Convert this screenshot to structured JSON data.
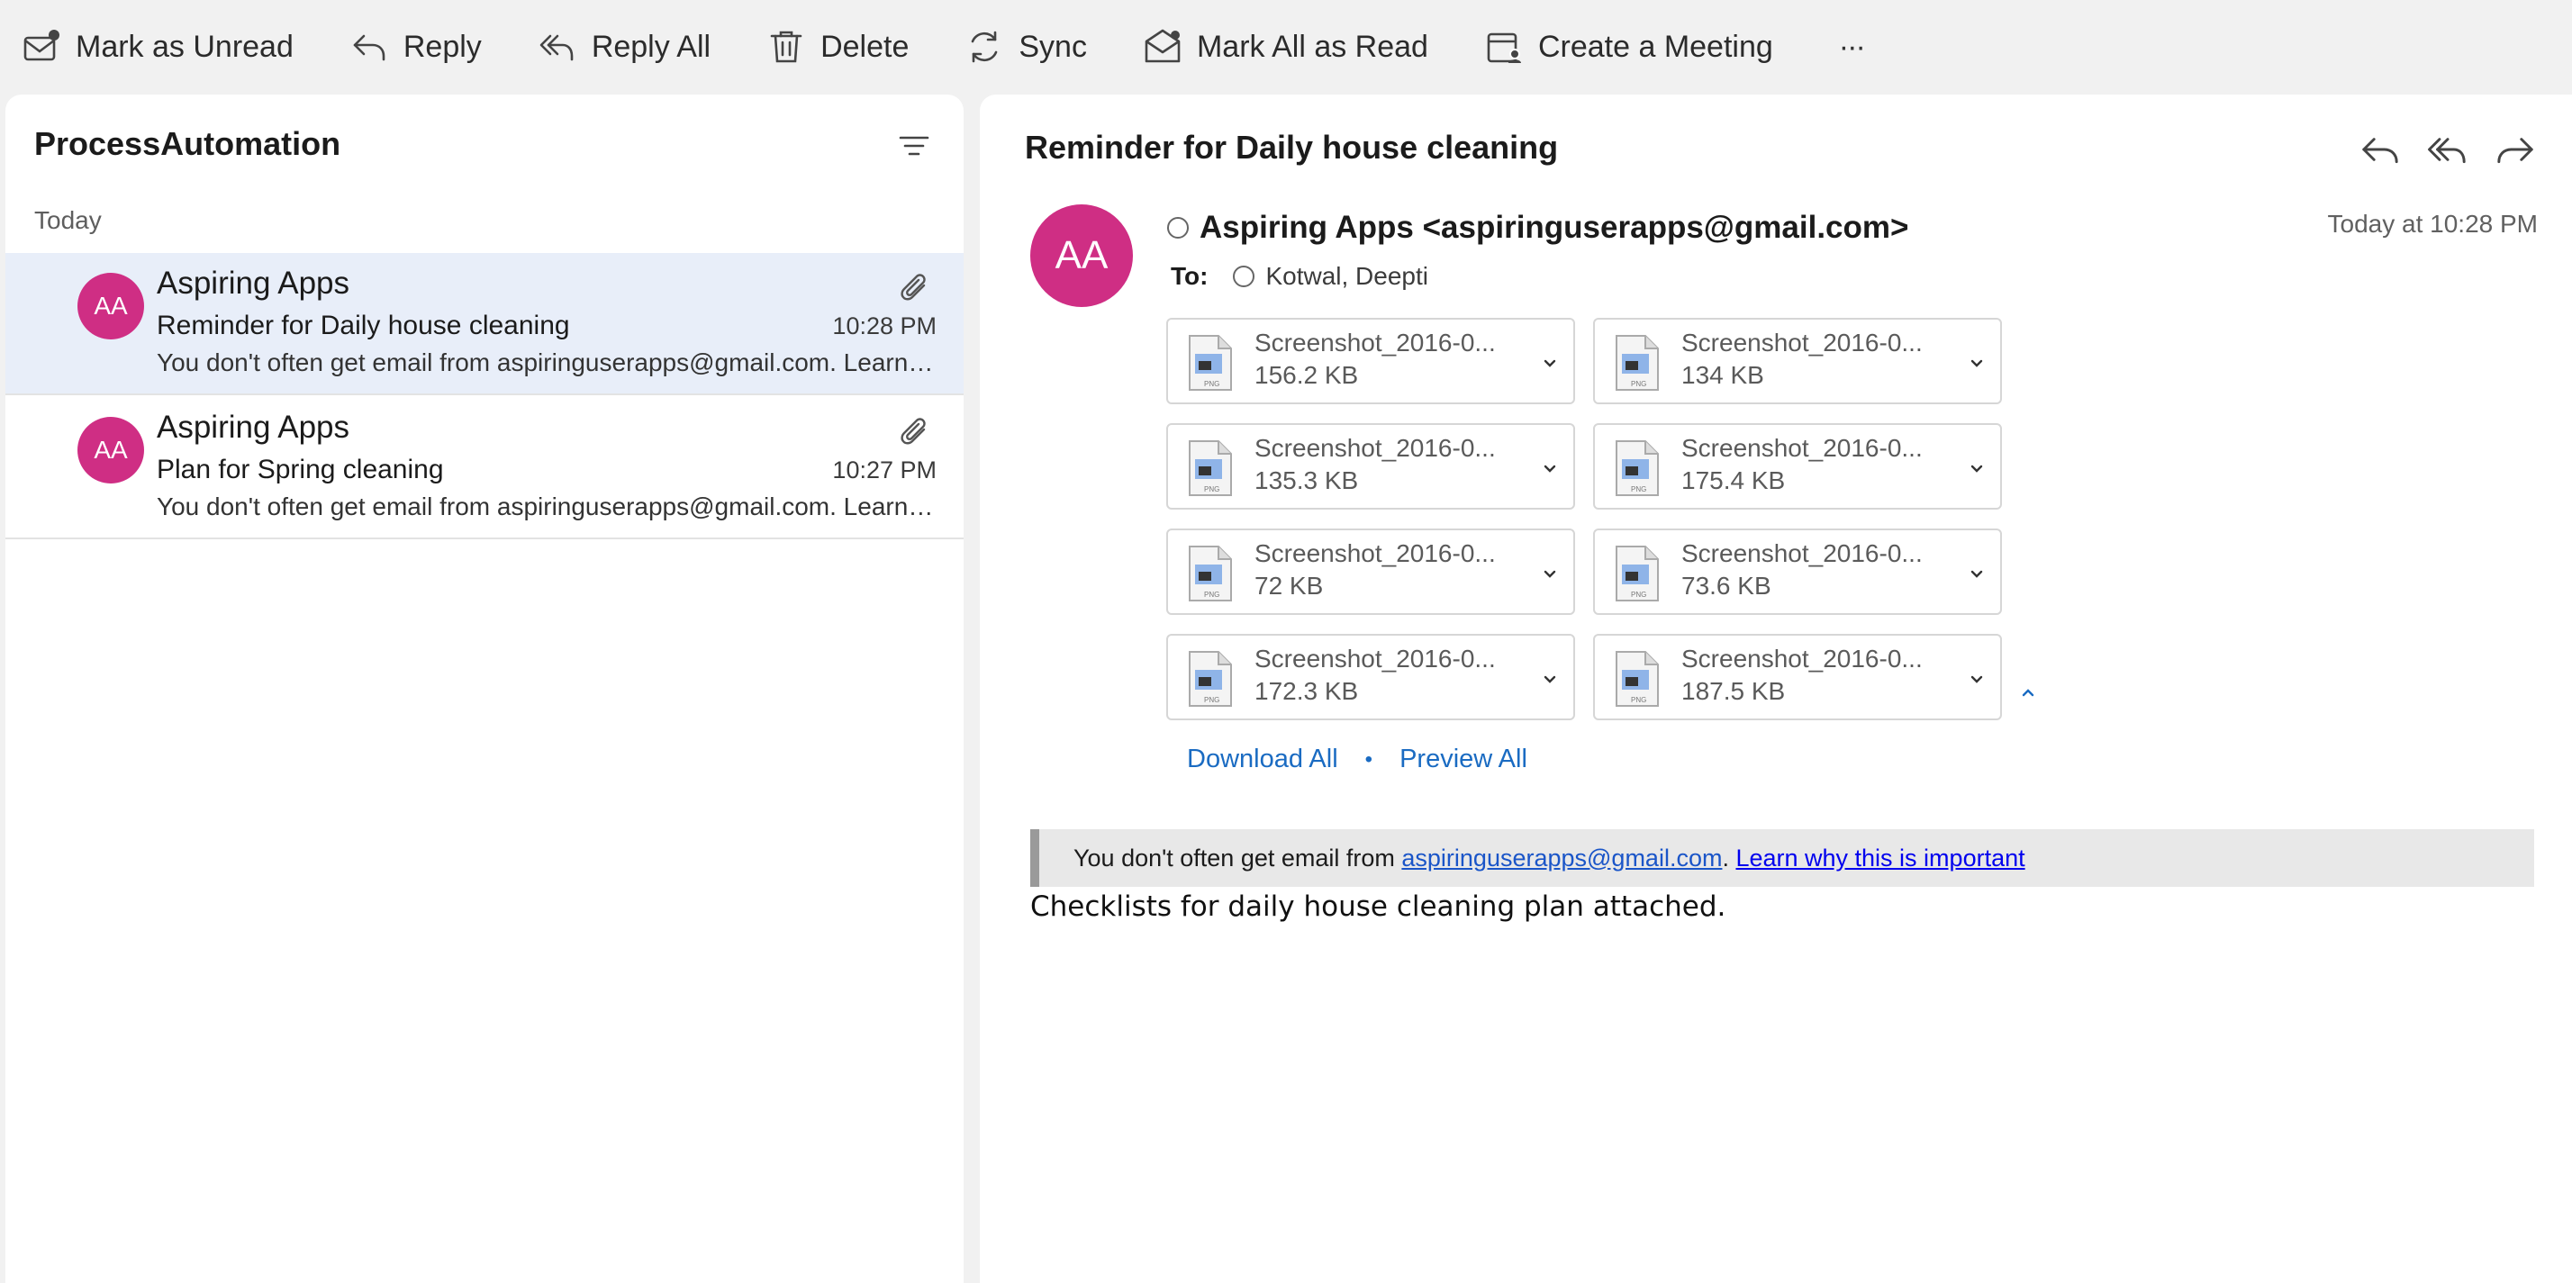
{
  "toolbar": {
    "mark_unread": "Mark as Unread",
    "reply": "Reply",
    "reply_all": "Reply All",
    "delete": "Delete",
    "sync": "Sync",
    "mark_all_read": "Mark All as Read",
    "create_meeting": "Create a Meeting",
    "more": "···"
  },
  "list": {
    "folder": "ProcessAutomation",
    "group": "Today",
    "messages": [
      {
        "initials": "AA",
        "sender": "Aspiring Apps",
        "subject": "Reminder for Daily house cleaning",
        "time": "10:28 PM",
        "preview": "You don't often get email from aspiringuserapps@gmail.com. Learn why this is important"
      },
      {
        "initials": "AA",
        "sender": "Aspiring Apps",
        "subject": "Plan for Spring cleaning",
        "time": "10:27 PM",
        "preview": "You don't often get email from aspiringuserapps@gmail.com. Learn why this is important"
      }
    ]
  },
  "reading": {
    "subject": "Reminder for Daily house cleaning",
    "initials": "AA",
    "from": "Aspiring Apps <aspiringuserapps@gmail.com>",
    "date": "Today at 10:28 PM",
    "to_label": "To:",
    "to_name": "Kotwal, Deepti",
    "attachments": [
      {
        "name": "Screenshot_2016-0...",
        "size": "156.2 KB"
      },
      {
        "name": "Screenshot_2016-0...",
        "size": "134 KB"
      },
      {
        "name": "Screenshot_2016-0...",
        "size": "135.3 KB"
      },
      {
        "name": "Screenshot_2016-0...",
        "size": "175.4 KB"
      },
      {
        "name": "Screenshot_2016-0...",
        "size": "72 KB"
      },
      {
        "name": "Screenshot_2016-0...",
        "size": "73.6 KB"
      },
      {
        "name": "Screenshot_2016-0...",
        "size": "172.3 KB"
      },
      {
        "name": "Screenshot_2016-0...",
        "size": "187.5 KB"
      }
    ],
    "download_all": "Download All",
    "link_separator": "•",
    "preview_all": "Preview All",
    "banner_text": "You don't often get email from ",
    "banner_email": "aspiringuserapps@gmail.com",
    "banner_period": ". ",
    "banner_link": "Learn why this is important",
    "body": "Checklists for daily house cleaning plan attached."
  },
  "colors": {
    "avatar": "#cf2e84",
    "link": "#1a6bc2",
    "selected_row": "#e8eef9"
  }
}
